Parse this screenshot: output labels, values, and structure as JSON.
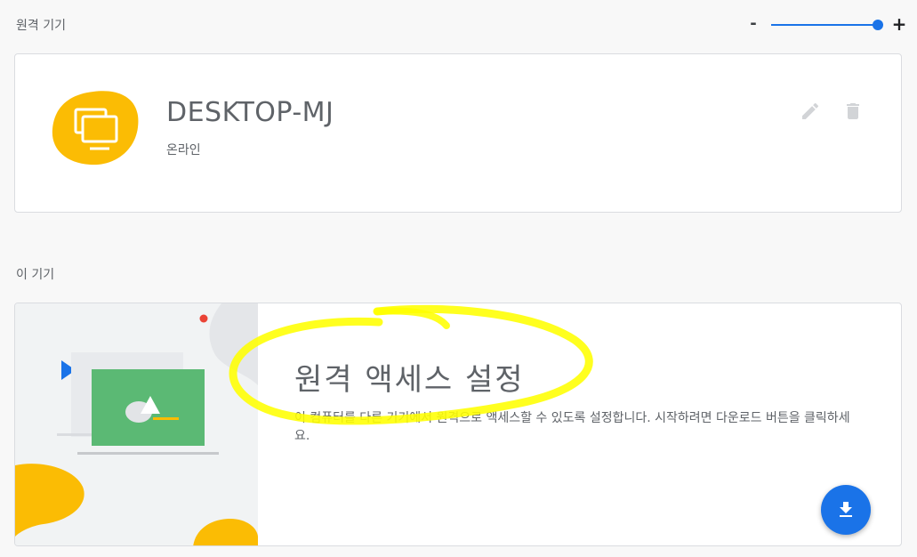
{
  "sections": {
    "remote_devices_label": "원격 기기",
    "this_device_label": "이 기기"
  },
  "zoom": {
    "minus_label": "-",
    "plus_label": "+",
    "level": 1.0
  },
  "device": {
    "name": "DESKTOP-MJ",
    "status": "온라인",
    "icon": "monitor-icon",
    "edit_icon": "pencil-icon",
    "delete_icon": "trash-icon"
  },
  "this_device": {
    "title": "원격 액세스 설정",
    "description": "이 컴퓨터를 다른 기기에서 원격으로 액세스할 수 있도록 설정합니다. 시작하려면 다운로드 버튼을 클릭하세요.",
    "download_icon": "download-icon"
  },
  "colors": {
    "accent": "#1a73e8",
    "device_yellow": "#fbbc04",
    "illustration_green": "#5bb974",
    "highlight_yellow": "#ffff00",
    "dot_red": "#ea4335"
  }
}
